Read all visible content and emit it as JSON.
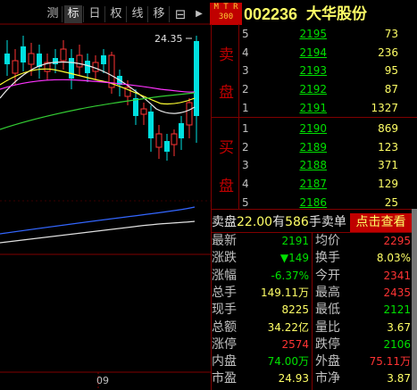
{
  "toolbar": {
    "items": [
      {
        "label": "测"
      },
      {
        "label": "标"
      },
      {
        "label": "日"
      },
      {
        "label": "权"
      },
      {
        "label": "线"
      },
      {
        "label": "移"
      }
    ],
    "icon_box": "⊟",
    "icon_arrow": "▶",
    "logo_lines": [
      "M T R",
      "300"
    ]
  },
  "stock": {
    "code": "002236",
    "name": "大华股份"
  },
  "chart": {
    "peak_label": "24.35",
    "axis_marker": "09"
  },
  "orderbook": {
    "sell_label": [
      "卖",
      "盘"
    ],
    "buy_label": [
      "买",
      "盘"
    ],
    "sell": [
      {
        "level": "5",
        "price": "2195",
        "vol": "73"
      },
      {
        "level": "4",
        "price": "2194",
        "vol": "236"
      },
      {
        "level": "3",
        "price": "2193",
        "vol": "95"
      },
      {
        "level": "2",
        "price": "2192",
        "vol": "87"
      },
      {
        "level": "1",
        "price": "2191",
        "vol": "1327"
      }
    ],
    "buy": [
      {
        "level": "1",
        "price": "2190",
        "vol": "869"
      },
      {
        "level": "2",
        "price": "2189",
        "vol": "123"
      },
      {
        "level": "3",
        "price": "2188",
        "vol": "371"
      },
      {
        "level": "4",
        "price": "2187",
        "vol": "129"
      },
      {
        "level": "5",
        "price": "2186",
        "vol": "25"
      }
    ]
  },
  "summary": {
    "text_a": "卖盘",
    "price": "22.00",
    "text_b": "有",
    "qty": "586",
    "text_c": "手卖单",
    "lookup": "点击查看"
  },
  "stats": [
    {
      "l1": "最新",
      "v1": "2191",
      "c1": "g",
      "l2": "均价",
      "v2": "2295",
      "c2": "r"
    },
    {
      "l1": "涨跌",
      "v1": "▼149",
      "c1": "g",
      "l2": "换手",
      "v2": "8.03%",
      "c2": "y"
    },
    {
      "l1": "涨幅",
      "v1": "-6.37%",
      "c1": "g",
      "l2": "今开",
      "v2": "2341",
      "c2": "r"
    },
    {
      "l1": "总手",
      "v1": "149.11万",
      "c1": "y",
      "l2": "最高",
      "v2": "2435",
      "c2": "r"
    },
    {
      "l1": "现手",
      "v1": "8225",
      "c1": "y",
      "l2": "最低",
      "v2": "2121",
      "c2": "g"
    },
    {
      "l1": "总额",
      "v1": "34.22亿",
      "c1": "y",
      "l2": "量比",
      "v2": "3.67",
      "c2": "y"
    },
    {
      "l1": "涨停",
      "v1": "2574",
      "c1": "r",
      "l2": "跌停",
      "v2": "2106",
      "c2": "g"
    },
    {
      "l1": "内盘",
      "v1": "74.00万",
      "c1": "g",
      "l2": "外盘",
      "v2": "75.11万",
      "c2": "r"
    },
    {
      "l1": "市盈",
      "v1": "24.93",
      "c1": "y",
      "l2": "市净",
      "v2": "3.87",
      "c2": "y"
    }
  ],
  "colors": {
    "up": "#ff3333",
    "down": "#00e0e0",
    "grid": "#800000",
    "accent": "#ffff66"
  }
}
